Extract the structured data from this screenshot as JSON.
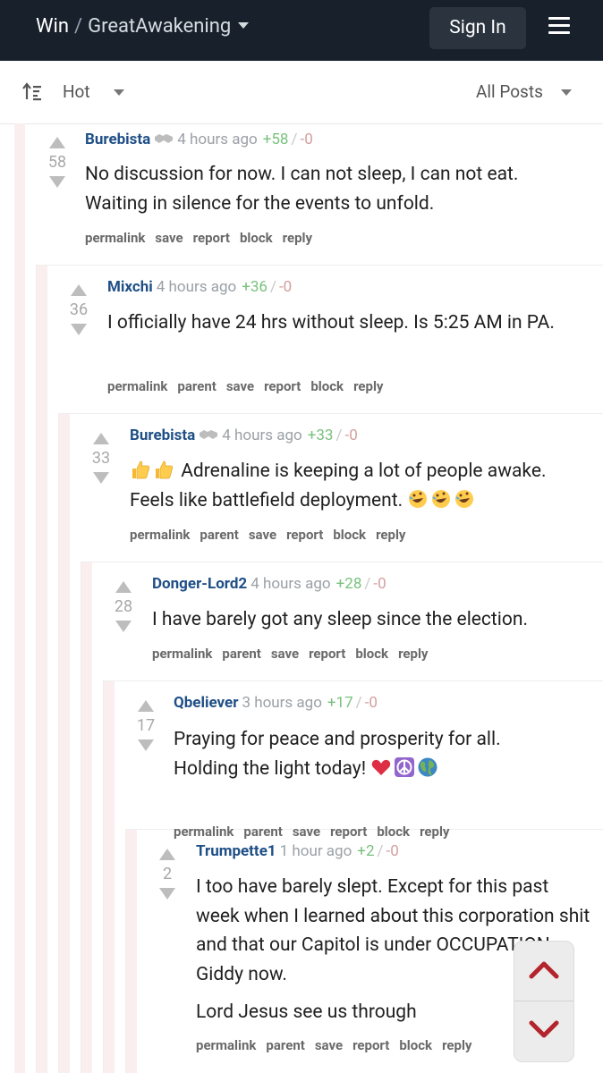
{
  "header": {
    "site": "Win",
    "separator": "/",
    "community": "GreatAwakening",
    "sign_in": "Sign In"
  },
  "sortbar": {
    "sort": "Hot",
    "filter": "All Posts"
  },
  "comments": [
    {
      "author": "Burebista",
      "handshake": true,
      "time": "4 hours ago",
      "up": "+58",
      "down": "-0",
      "score": "58",
      "body": [
        "No discussion for now. I can not sleep, I can not eat. Waiting in silence for the events to unfold."
      ],
      "actions": [
        "permalink",
        "save",
        "report",
        "block",
        "reply"
      ]
    },
    {
      "author": "Mixchi",
      "handshake": false,
      "time": "4 hours ago",
      "up": "+36",
      "down": "-0",
      "score": "36",
      "body": [
        "I officially have 24 hrs without sleep. Is 5:25 AM in PA."
      ],
      "actions": [
        "permalink",
        "parent",
        "save",
        "report",
        "block",
        "reply"
      ]
    },
    {
      "author": "Burebista",
      "handshake": true,
      "time": "4 hours ago",
      "up": "+33",
      "down": "-0",
      "score": "33",
      "body_line1": "Adrenaline is keeping a lot of people awake.",
      "body_line2": "Feels like battlefield deployment.",
      "actions": [
        "permalink",
        "parent",
        "save",
        "report",
        "block",
        "reply"
      ]
    },
    {
      "author": "Donger-Lord2",
      "handshake": false,
      "time": "4 hours ago",
      "up": "+28",
      "down": "-0",
      "score": "28",
      "body": [
        "I have barely got any sleep since the election."
      ],
      "actions": [
        "permalink",
        "parent",
        "save",
        "report",
        "block",
        "reply"
      ]
    },
    {
      "author": "Qbeliever",
      "handshake": false,
      "time": "3 hours ago",
      "up": "+17",
      "down": "-0",
      "score": "17",
      "body_line1": "Praying for peace and prosperity for all.",
      "body_line2": "Holding the light today!",
      "actions": [
        "permalink",
        "parent",
        "save",
        "report",
        "block",
        "reply"
      ]
    },
    {
      "author": "Trumpette1",
      "handshake": false,
      "time": "1 hour ago",
      "up": "+2",
      "down": "-0",
      "score": "2",
      "body": [
        "I too have barely slept. Except for this past week when I learned about this corporation shit and that our Capitol is under OCCUPATION. Giddy now.",
        "Lord Jesus see us through"
      ],
      "actions": [
        "permalink",
        "parent",
        "save",
        "report",
        "block",
        "reply"
      ]
    }
  ],
  "colors": {
    "topbar": "#17202b",
    "author": "#1f4f86",
    "upvote": "#79c17d",
    "downvote": "#d39e9e",
    "arrows": "#b3242c"
  }
}
